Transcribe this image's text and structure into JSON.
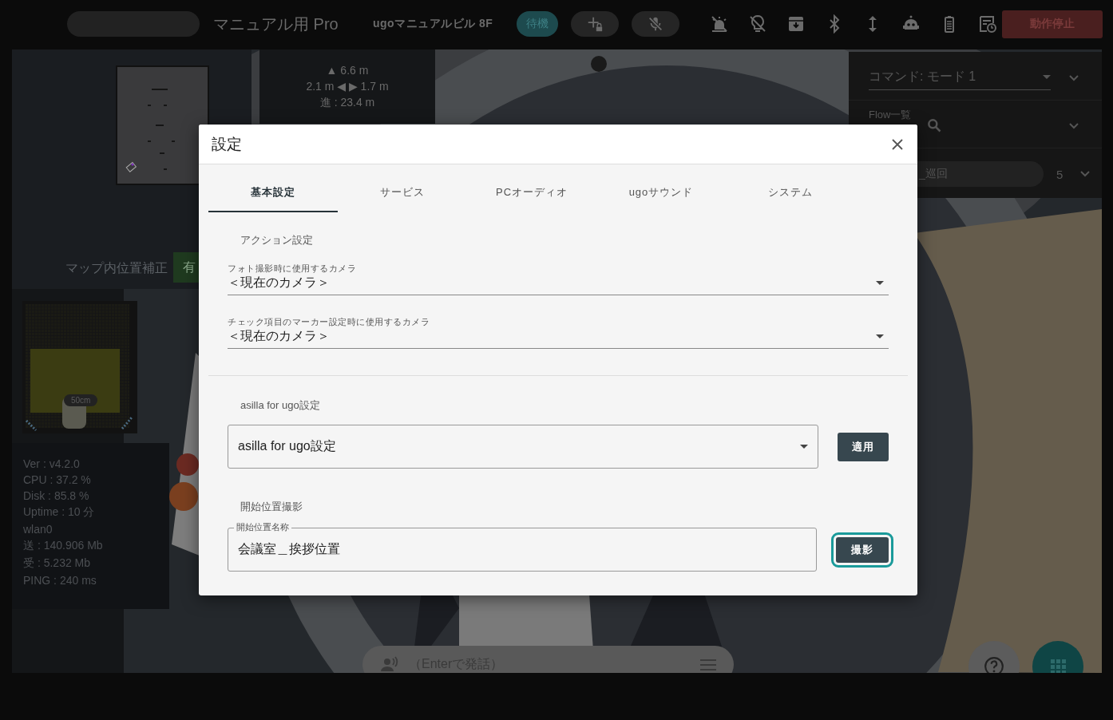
{
  "top_bar": {
    "title": "マニュアル用 Pro",
    "location": "ugoマニュアルビル 8F",
    "status_badge": "待機",
    "stop_button": "動作停止"
  },
  "map_panel": {
    "label": "マップ内位置補正",
    "toggle_label": "有"
  },
  "distance_panel": {
    "lines": [
      "▲ 6.6 m",
      "2.1 m ◀ ▶ 1.7 m",
      "進 : 23.4 m"
    ]
  },
  "command_panel": {
    "command_select": "コマンド: モード 1",
    "flow_label": "Flow一覧",
    "flow_chip": "_巡回",
    "flow_count": "5"
  },
  "obstacle_panel": {
    "scale_label": "50cm"
  },
  "stats": [
    "Ver : v4.2.0",
    "CPU : 37.2 %",
    "Disk : 85.8 %",
    "Uptime : 10 分",
    "wlan0",
    "送 : 140.906 Mb",
    "受 : 5.232 Mb",
    "PING : 240 ms"
  ],
  "speech_bar": {
    "placeholder": "（Enterで発話）"
  },
  "dialog": {
    "title": "設定",
    "tabs": [
      {
        "label": "基本設定",
        "selected": true
      },
      {
        "label": "サービス",
        "selected": false
      },
      {
        "label": "PCオーディオ",
        "selected": false
      },
      {
        "label": "ugoサウンド",
        "selected": false
      },
      {
        "label": "システム",
        "selected": false
      }
    ],
    "action_section": {
      "heading": "アクション設定",
      "fields": [
        {
          "label": "フォト撮影時に使用するカメラ",
          "value": "＜現在のカメラ＞"
        },
        {
          "label": "チェック項目のマーカー設定時に使用するカメラ",
          "value": "＜現在のカメラ＞"
        }
      ]
    },
    "asilla_section": {
      "heading": "asilla for ugo設定",
      "select_value": "asilla for ugo設定",
      "apply_button": "適用"
    },
    "start_section": {
      "heading": "開始位置撮影",
      "field_label": "開始位置名称",
      "value": "会議室＿挨拶位置",
      "capture_button": "撮影",
      "capture_focused": true
    }
  }
}
